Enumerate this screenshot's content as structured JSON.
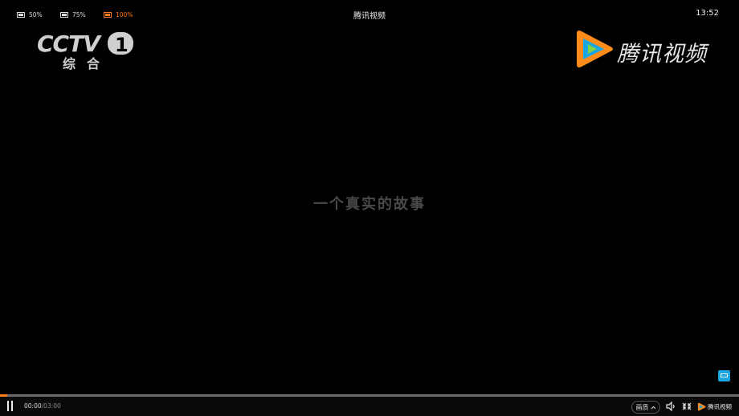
{
  "top_bar": {
    "size_options": [
      {
        "label": "50%",
        "active": false
      },
      {
        "label": "75%",
        "active": false
      },
      {
        "label": "100%",
        "active": true
      }
    ],
    "title": "腾讯视频",
    "clock": "13:52"
  },
  "video": {
    "channel_logo": {
      "main": "CCTV",
      "number": "1",
      "sub": "综合"
    },
    "brand_logo": {
      "text": "腾讯视频"
    },
    "subtitle": "一个真实的故事"
  },
  "player": {
    "progress": 0.01,
    "current_time": "00:00",
    "total_time": "03:00",
    "quality_label": "画质",
    "mini_brand": "腾讯视频"
  },
  "colors": {
    "accent": "#ff7a1a",
    "brand_blue": "#1aa6e0",
    "background": "#000000"
  }
}
